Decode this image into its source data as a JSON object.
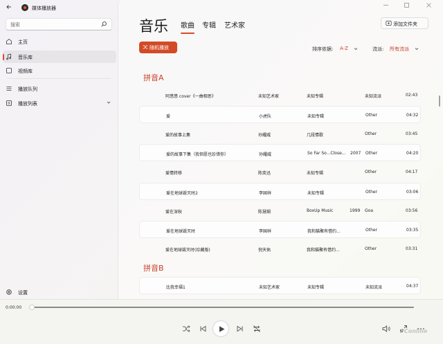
{
  "app": {
    "title": "媒体播放器"
  },
  "sidebar": {
    "search_placeholder": "搜索",
    "items": [
      {
        "label": "主页",
        "icon": "home-icon"
      },
      {
        "label": "音乐库",
        "icon": "music-note-icon",
        "active": true
      },
      {
        "label": "视频库",
        "icon": "video-icon"
      },
      {
        "label": "播放队列",
        "icon": "queue-icon"
      },
      {
        "label": "播放列表",
        "icon": "playlist-icon"
      }
    ],
    "settings_label": "设置"
  },
  "main": {
    "title": "音乐",
    "tabs": [
      "歌曲",
      "专辑",
      "艺术家"
    ],
    "add_folder_label": "添加文件夹",
    "shuffle_label": "随机播放",
    "sort_label": "排序依据:",
    "sort_value": "A-Z",
    "genre_label": "流派:",
    "genre_value": "所有流派",
    "groups": [
      {
        "header": "拼音A",
        "songs": [
          {
            "title": "阿悠悠 cover《一曲相思》",
            "artist": "未知艺术家",
            "album": "未知专辑",
            "year": "",
            "genre": "未知流派",
            "duration": "02:43"
          },
          {
            "title": "爱",
            "artist": "小虎队",
            "album": "未知专辑",
            "year": "",
            "genre": "Other",
            "duration": "04:32"
          },
          {
            "title": "爱的故事上集",
            "artist": "孙耀威",
            "album": "几段情歌",
            "year": "",
            "genre": "Other",
            "duration": "03:45"
          },
          {
            "title": "爱的故事下集（我但愿也珍惜你）",
            "artist": "孙耀威",
            "album": "So Far So...Close...",
            "year": "2007",
            "genre": "Other",
            "duration": "04:20"
          },
          {
            "title": "爱情转移",
            "artist": "陈奕迅",
            "album": "未知专辑",
            "year": "",
            "genre": "Other",
            "duration": "04:17"
          },
          {
            "title": "爱在地球毁灭时2",
            "artist": "李国祥",
            "album": "未知专辑",
            "year": "",
            "genre": "Other",
            "duration": "03:06"
          },
          {
            "title": "爱在深秋",
            "artist": "陈慧娴",
            "album": "BoxUp Music",
            "year": "1999",
            "genre": "Goa",
            "duration": "03:56"
          },
          {
            "title": "爱在地球毁灭时",
            "artist": "李国祥",
            "album": "我和猫聚有借约...",
            "year": "",
            "genre": "Other",
            "duration": "03:35"
          },
          {
            "title": "爱在地球毁灭时(珍藏版)",
            "artist": "倪天佑",
            "album": "我和猫聚有借约...",
            "year": "",
            "genre": "Other",
            "duration": "03:31"
          }
        ]
      },
      {
        "header": "拼音B",
        "songs": [
          {
            "title": "比我幸福1",
            "artist": "未知艺术家",
            "album": "未知专辑",
            "year": "",
            "genre": "未知流派",
            "duration": "04:37"
          }
        ]
      }
    ]
  },
  "player": {
    "current_time": "0:00:00",
    "progress": 0
  },
  "watermark": "PConline",
  "colors": {
    "accent": "#d34a26",
    "accent_text": "#c8412a"
  }
}
